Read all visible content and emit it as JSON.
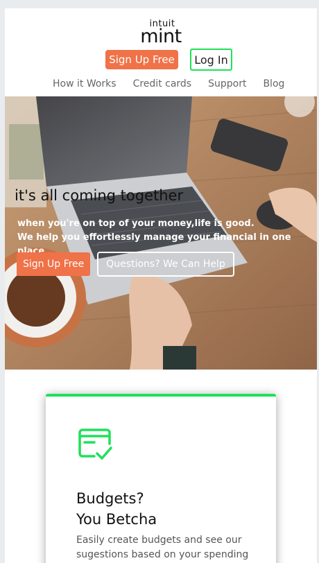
{
  "brand": {
    "logo_top": "intuit",
    "logo_main": "mint"
  },
  "header": {
    "signup_label": "Sign Up Free",
    "login_label": "Log In"
  },
  "nav": {
    "items": [
      "How it Works",
      "Credit cards",
      "Support",
      "Blog"
    ]
  },
  "hero": {
    "title": "it's all coming together",
    "subtitle_line1": "when you're on top of your money,life is good.",
    "subtitle_line2": "We help you effortlessly manage your financial in one place",
    "signup_label": "Sign Up Free",
    "questions_label": "Questions? We Can Help"
  },
  "card": {
    "icon": "credit-card-check-icon",
    "title_line1": "Budgets?",
    "title_line2": "You Betcha",
    "text": "Easily create budgets and see our sugestions based on your spending"
  },
  "colors": {
    "accent_orange": "#ef7248",
    "accent_green": "#1ee15a"
  }
}
